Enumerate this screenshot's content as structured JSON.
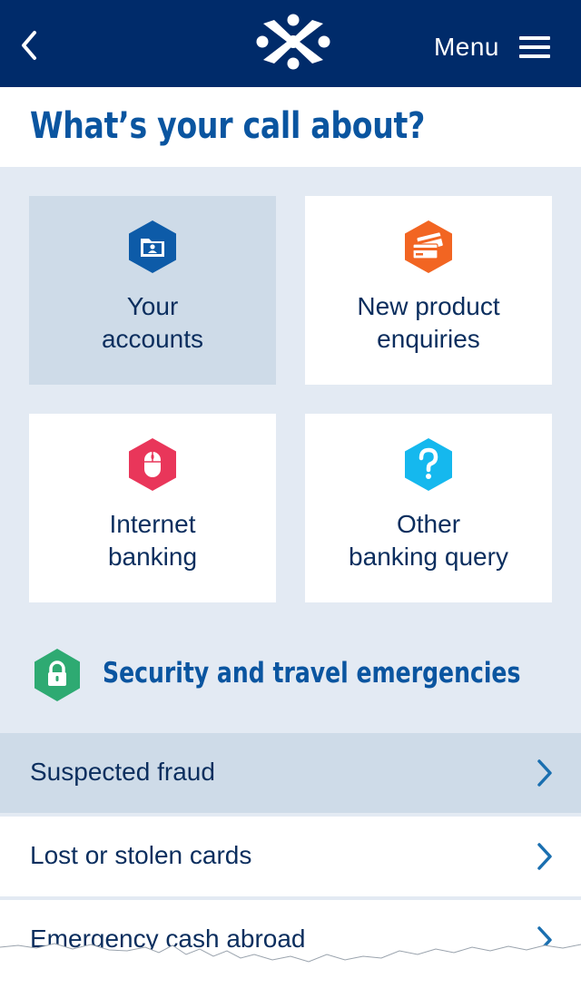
{
  "header": {
    "menu_label": "Menu",
    "icons": {
      "back": "chevron-left-icon",
      "logo": "bank-logo",
      "menu": "hamburger-icon"
    },
    "background": "#002b6a"
  },
  "page": {
    "title": "What’s your call about?"
  },
  "tiles": [
    {
      "line1": "Your",
      "line2": "accounts",
      "icon": "account-folder-icon",
      "icon_color": "#0d5ba8",
      "selected": true
    },
    {
      "line1": "New product",
      "line2": "enquiries",
      "icon": "credit-cards-icon",
      "icon_color": "#f26522",
      "selected": false
    },
    {
      "line1": "Internet",
      "line2": "banking",
      "icon": "mouse-icon",
      "icon_color": "#e9365a",
      "selected": false
    },
    {
      "line1": "Other",
      "line2": "banking query",
      "icon": "question-icon",
      "icon_color": "#15b8ee",
      "selected": false
    }
  ],
  "security": {
    "title": "Security and travel emergencies",
    "icon": "padlock-icon",
    "icon_color": "#2eaa72",
    "items": [
      {
        "label": "Suspected fraud",
        "selected": true
      },
      {
        "label": "Lost or stolen cards",
        "selected": false
      },
      {
        "label": "Emergency cash abroad",
        "selected": false
      }
    ]
  },
  "colors": {
    "accent": "#0a55a0",
    "text": "#0b2e5e",
    "panel": "#e3eaf3",
    "selected": "#cedbe8",
    "chevron": "#1a6fb0"
  }
}
